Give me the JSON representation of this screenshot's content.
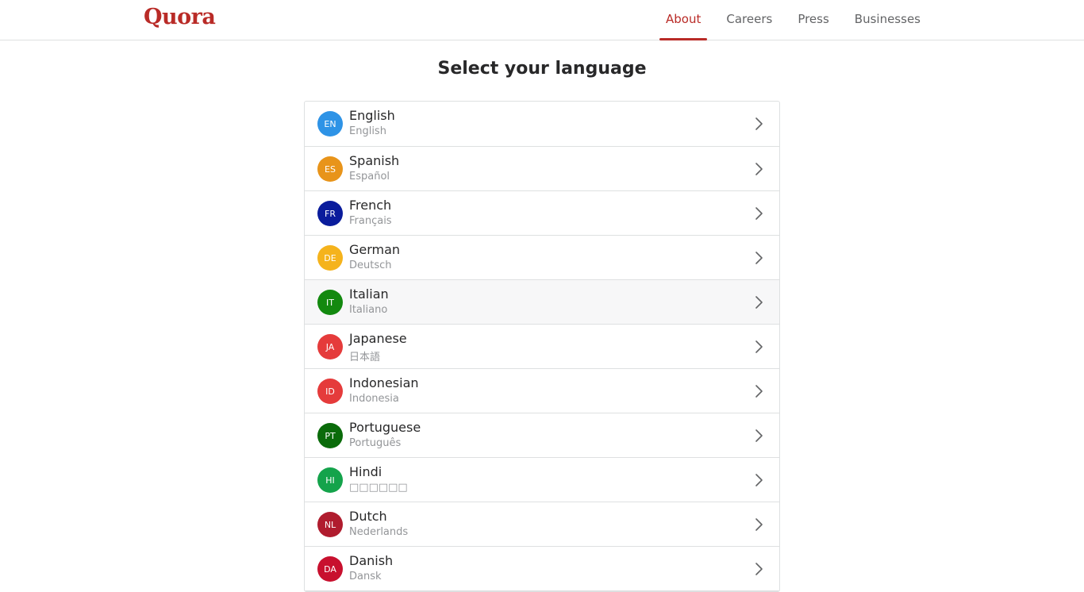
{
  "header": {
    "logo": "Quora",
    "nav": [
      {
        "label": "About",
        "active": true
      },
      {
        "label": "Careers",
        "active": false
      },
      {
        "label": "Press",
        "active": false
      },
      {
        "label": "Businesses",
        "active": false
      }
    ],
    "accent_color": "#b92b27"
  },
  "page_title": "Select your language",
  "chevron_icon": "chevron-right-icon",
  "languages": [
    {
      "code": "EN",
      "name": "English",
      "native": "English",
      "color": "#2e93e6"
    },
    {
      "code": "ES",
      "name": "Spanish",
      "native": "Español",
      "color": "#e8941a"
    },
    {
      "code": "FR",
      "name": "French",
      "native": "Français",
      "color": "#0a1c9c"
    },
    {
      "code": "DE",
      "name": "German",
      "native": "Deutsch",
      "color": "#f5b31c"
    },
    {
      "code": "IT",
      "name": "Italian",
      "native": "Italiano",
      "color": "#13890f",
      "hover": true
    },
    {
      "code": "JA",
      "name": "Japanese",
      "native": "日本語",
      "color": "#e53b3b"
    },
    {
      "code": "ID",
      "name": "Indonesian",
      "native": "Indonesia",
      "color": "#e53b3b"
    },
    {
      "code": "PT",
      "name": "Portuguese",
      "native": "Português",
      "color": "#0a6b0a"
    },
    {
      "code": "HI",
      "name": "Hindi",
      "native": "□□□□□□",
      "color": "#14a34b"
    },
    {
      "code": "NL",
      "name": "Dutch",
      "native": "Nederlands",
      "color": "#b01c2e"
    },
    {
      "code": "DA",
      "name": "Danish",
      "native": "Dansk",
      "color": "#c8102e"
    }
  ]
}
